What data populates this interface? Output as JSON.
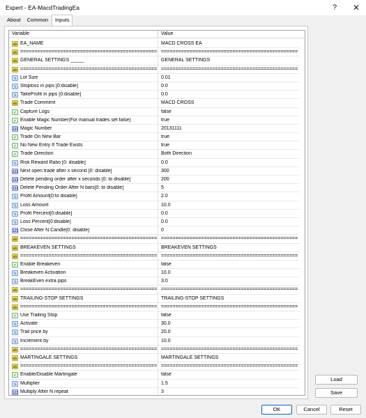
{
  "window": {
    "title": "Expert - EA-MacdTradingEa",
    "help_label": "?",
    "close_label": "✕"
  },
  "tabs": [
    {
      "label": "About"
    },
    {
      "label": "Common"
    },
    {
      "label": "Inputs"
    }
  ],
  "grid": {
    "variable_header": "Variable",
    "value_header": "Value",
    "rows": [
      {
        "icon": "ab",
        "variable": "EA_NAME",
        "value": "MACD CROSS EA"
      },
      {
        "icon": "ab",
        "variable": "================================================================",
        "value": "================================================================"
      },
      {
        "icon": "ab",
        "variable": "GENERAL SETTINGS _____",
        "value": "GENERAL SETTINGS"
      },
      {
        "icon": "ab",
        "variable": "================================================================",
        "value": "================================================================"
      },
      {
        "icon": "1/2",
        "variable": "Lot Size",
        "value": "0.01"
      },
      {
        "icon": "1/2",
        "variable": "Stoploss in pips [0:disable]",
        "value": "0.0"
      },
      {
        "icon": "1/2",
        "variable": "TakeProfit in pips [0:disable]",
        "value": "0.0"
      },
      {
        "icon": "ab",
        "variable": "Trade Comment",
        "value": "MACD CROSS"
      },
      {
        "icon": "bool",
        "variable": "Capture Logs",
        "value": "false"
      },
      {
        "icon": "bool",
        "variable": "Enable Magic Number(For manual trades set false)",
        "value": "true"
      },
      {
        "icon": "123",
        "variable": "Magic Number",
        "value": "20131111"
      },
      {
        "icon": "bool",
        "variable": "Trade On New Bar",
        "value": "true"
      },
      {
        "icon": "bool",
        "variable": "No New Entry If Trade Exists",
        "value": "true"
      },
      {
        "icon": "bool",
        "variable": "Trade Direction",
        "value": "Both Direction"
      },
      {
        "icon": "1/2",
        "variable": "Risk Reward Ratio [0: disable]",
        "value": "0.0"
      },
      {
        "icon": "123",
        "variable": "Next open trade after x second [0: disable]",
        "value": "300"
      },
      {
        "icon": "123",
        "variable": "Delete pending order after x seconds [0: to disable]",
        "value": "200"
      },
      {
        "icon": "123",
        "variable": "Delete Pending Order After N bars[0: to disable]",
        "value": "5"
      },
      {
        "icon": "1/2",
        "variable": "Profit Amount[0:to disable]",
        "value": "2.0"
      },
      {
        "icon": "1/2",
        "variable": "Loss Amount",
        "value": "10.0"
      },
      {
        "icon": "1/2",
        "variable": "Profit Percent[0:disable]",
        "value": "0.0"
      },
      {
        "icon": "1/2",
        "variable": "Loss Percent[0:disable]",
        "value": "0.0"
      },
      {
        "icon": "123",
        "variable": "Close After N Candle[0: disable]",
        "value": "0"
      },
      {
        "icon": "ab",
        "variable": "================================================================",
        "value": "================================================================"
      },
      {
        "icon": "ab",
        "variable": "BREAKEVEN SETTINGS",
        "value": "BREAKEVEN SETTINGS"
      },
      {
        "icon": "ab",
        "variable": "================================================================",
        "value": "================================================================"
      },
      {
        "icon": "bool",
        "variable": "Enable Breakeven",
        "value": "false"
      },
      {
        "icon": "1/2",
        "variable": "Breakeven Activation",
        "value": "10.0"
      },
      {
        "icon": "1/2",
        "variable": "BreakEven extra pips",
        "value": "3.0"
      },
      {
        "icon": "ab",
        "variable": "================================================================",
        "value": "================================================================"
      },
      {
        "icon": "ab",
        "variable": "TRAILING-STOP SETTINGS",
        "value": "TRAILING-STOP SETTINGS"
      },
      {
        "icon": "ab",
        "variable": "================================================================",
        "value": "================================================================"
      },
      {
        "icon": "bool",
        "variable": "Use Trailing Stop",
        "value": "false"
      },
      {
        "icon": "1/2",
        "variable": "Activate",
        "value": "30.0"
      },
      {
        "icon": "1/2",
        "variable": "Trail price by",
        "value": "20.0"
      },
      {
        "icon": "1/2",
        "variable": "Increment by",
        "value": "10.0"
      },
      {
        "icon": "ab",
        "variable": "================================================================",
        "value": "================================================================"
      },
      {
        "icon": "ab",
        "variable": "MARTINGALE SETTINGS",
        "value": "MARTINGALE SETTINGS"
      },
      {
        "icon": "ab",
        "variable": "================================================================",
        "value": "================================================================"
      },
      {
        "icon": "bool",
        "variable": "Enable/Disable Martingale",
        "value": "false"
      },
      {
        "icon": "1/2",
        "variable": "Multiplier",
        "value": "1.5"
      },
      {
        "icon": "123",
        "variable": "Multiply After N repeat",
        "value": "3"
      }
    ]
  },
  "buttons": {
    "load": "Load",
    "save": "Save",
    "ok": "OK",
    "cancel": "Cancel",
    "reset": "Reset"
  }
}
